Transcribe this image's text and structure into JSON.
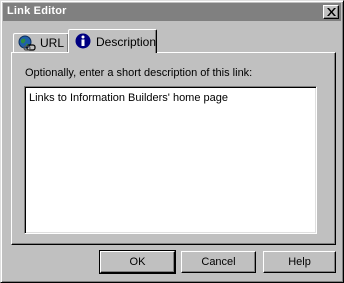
{
  "window": {
    "title": "Link Editor",
    "close_icon": "close-icon"
  },
  "tabs": [
    {
      "label": "URL",
      "icon": "globe-link-icon",
      "selected": false
    },
    {
      "label": "Description",
      "icon": "info-icon",
      "selected": true
    }
  ],
  "panel": {
    "prompt": "Optionally, enter a short description of this link:",
    "description_value": "Links to Information Builders' home page"
  },
  "buttons": {
    "ok": "OK",
    "cancel": "Cancel",
    "help": "Help"
  }
}
